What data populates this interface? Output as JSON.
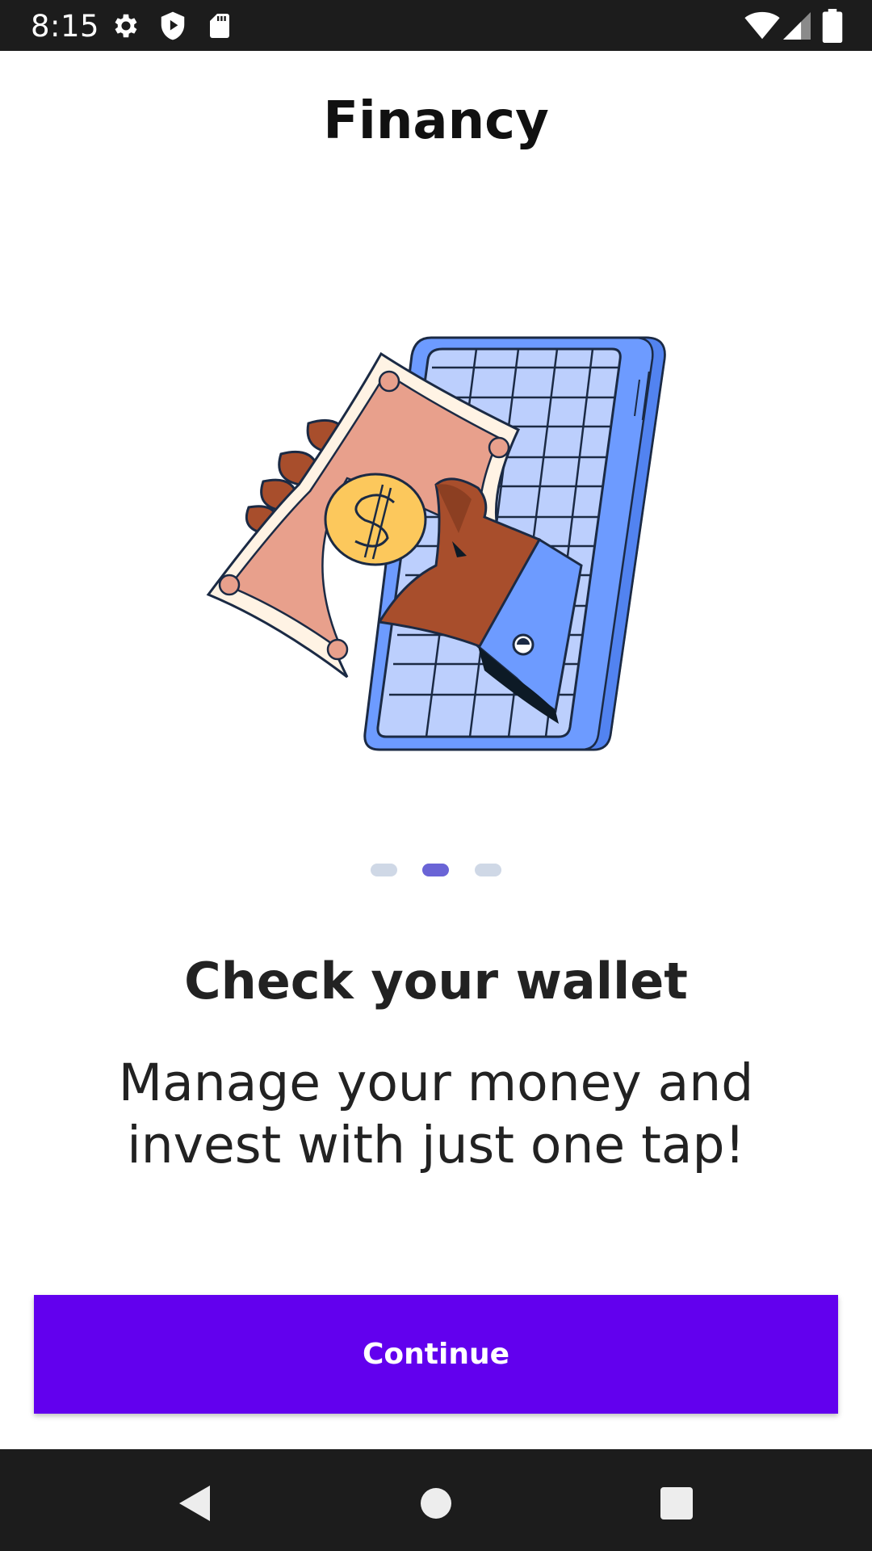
{
  "status_bar": {
    "time": "8:15",
    "icons": [
      "settings-icon",
      "shield-play-icon",
      "sd-card-icon",
      "wifi-icon",
      "cell-signal-icon",
      "battery-icon"
    ]
  },
  "header": {
    "title": "Financy"
  },
  "illustration": {
    "icon": "hand-cash-phone-illustration"
  },
  "pager": {
    "count": 3,
    "active_index": 1
  },
  "slide": {
    "title": "Check your wallet",
    "body_line1": "Manage your money and",
    "body_line2": "invest with just one tap!"
  },
  "actions": {
    "continue_label": "Continue"
  },
  "nav_bar": {
    "buttons": [
      "back-icon",
      "home-icon",
      "recents-icon"
    ]
  },
  "colors": {
    "accent": "#6200ee",
    "pager_active": "#6a64d6",
    "pager_inactive": "#cfd8e6",
    "system_bar": "#1c1c1c"
  }
}
